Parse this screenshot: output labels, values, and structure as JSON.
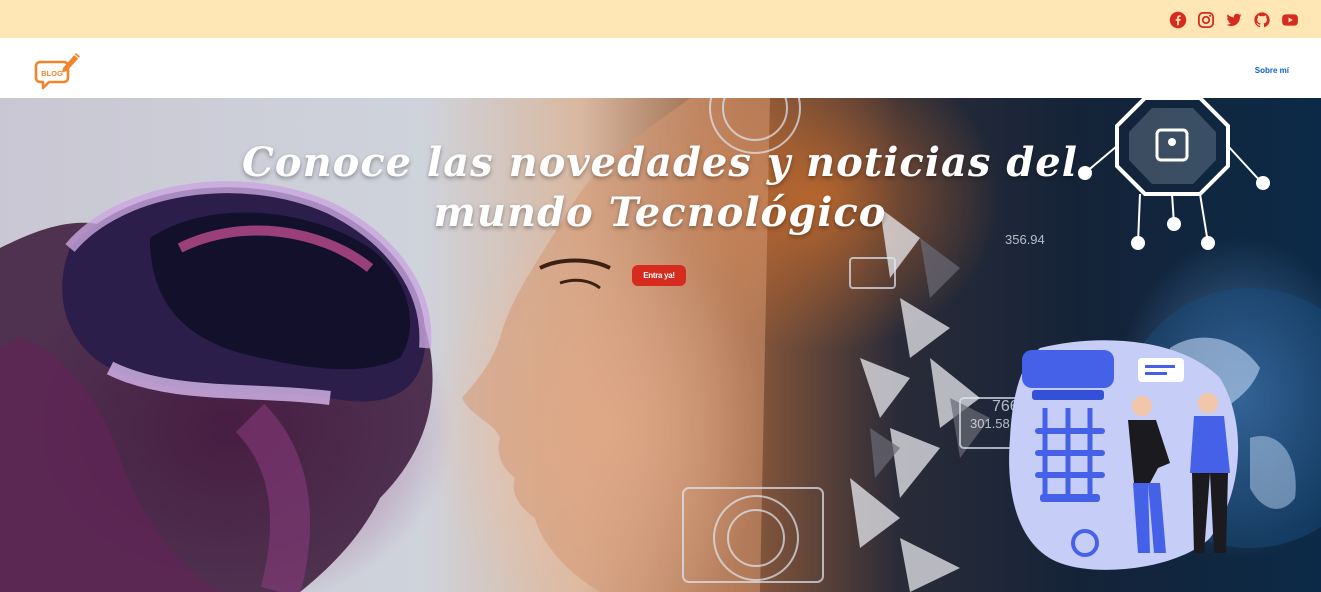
{
  "topbar": {
    "background": "#ffe7b5",
    "social_icons": [
      "facebook-icon",
      "instagram-icon",
      "twitter-icon",
      "github-icon",
      "youtube-icon"
    ],
    "icon_color": "#d62b1f"
  },
  "navbar": {
    "logo_text": "BLOG",
    "logo_color": "#f0852d",
    "links": [
      {
        "label": "Sobre mí"
      }
    ]
  },
  "hero": {
    "title": "Conoce las novedades y noticias del mundo Tecnológico",
    "cta_label": "Entra ya!",
    "cta_color": "#d62b1f",
    "overlay_numbers": [
      "356.94",
      "766",
      "301.58"
    ]
  }
}
